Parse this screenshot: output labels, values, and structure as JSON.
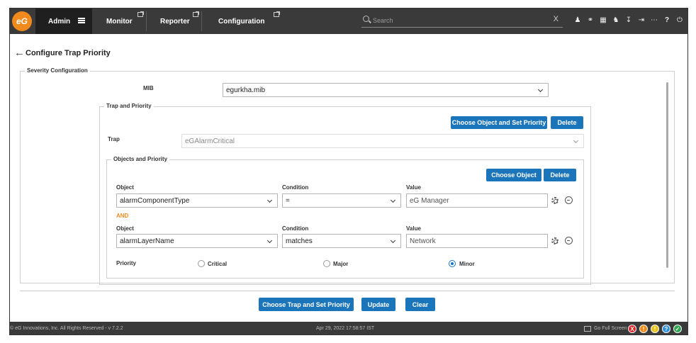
{
  "topbar": {
    "logo_text": "eG",
    "tabs": [
      {
        "label": "Admin"
      },
      {
        "label": "Monitor"
      },
      {
        "label": "Reporter"
      },
      {
        "label": "Configuration"
      }
    ],
    "search_placeholder": "Search",
    "search_clear": "X",
    "icons": [
      "user-icon",
      "link-icon",
      "chart-icon",
      "bell-icon",
      "download-icon",
      "signout-icon",
      "more-icon",
      "help-icon",
      "power-icon"
    ]
  },
  "page": {
    "title": "Configure Trap Priority"
  },
  "severity": {
    "legend": "Severity Configuration",
    "mib_label": "MIB",
    "mib_value": "egurkha.mib",
    "trap_priority": {
      "legend": "Trap and Priority",
      "choose_object_btn": "Choose Object and Set Priority",
      "delete_btn": "Delete",
      "trap_label": "Trap",
      "trap_value": "eGAlarmCritical",
      "objects": {
        "legend": "Objects and Priority",
        "choose_object_btn": "Choose Object",
        "delete_btn": "Delete",
        "rows": [
          {
            "object_label": "Object",
            "object_value": "alarmComponentType",
            "condition_label": "Condition",
            "condition_value": "=",
            "value_label": "Value",
            "value_value": "eG Manager"
          },
          {
            "object_label": "Object",
            "object_value": "alarmLayerName",
            "condition_label": "Condition",
            "condition_value": "matches",
            "value_label": "Value",
            "value_value": "Network"
          }
        ],
        "and_label": "AND",
        "priority_label": "Priority",
        "priorities": [
          {
            "label": "Critical",
            "checked": false
          },
          {
            "label": "Major",
            "checked": false
          },
          {
            "label": "Minor",
            "checked": true
          }
        ]
      }
    }
  },
  "actions": {
    "choose_trap": "Choose Trap and Set Priority",
    "update": "Update",
    "clear": "Clear"
  },
  "footer": {
    "copyright": "© eG Innovations, Inc. All Rights Reserved - v 7.2.2",
    "timestamp": "Apr 29, 2022 17:58:57 IST",
    "fullscreen": "Go Full Screen",
    "status": [
      {
        "name": "critical",
        "glyph": "X",
        "color": "#e02424"
      },
      {
        "name": "major",
        "glyph": "!",
        "color": "#f08a1c"
      },
      {
        "name": "minor",
        "glyph": "!",
        "color": "#e8c21a"
      },
      {
        "name": "unknown",
        "glyph": "?",
        "color": "#2f8fd8"
      },
      {
        "name": "normal",
        "glyph": "✓",
        "color": "#2fa84f"
      }
    ]
  }
}
